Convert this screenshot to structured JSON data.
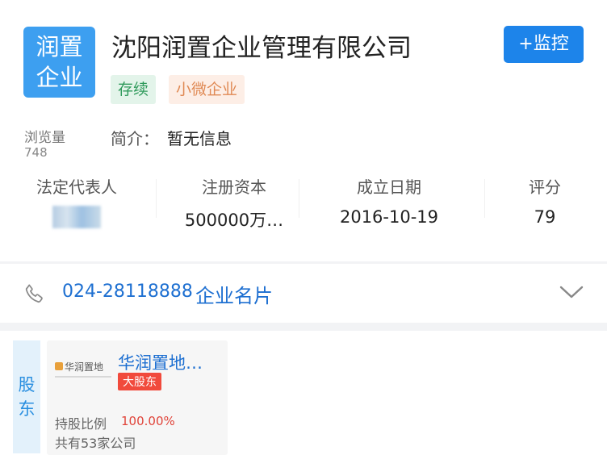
{
  "company": {
    "logo_line1": "润置",
    "logo_line2": "企业",
    "name": "沈阳润置企业管理有限公司",
    "status_tag": "存续",
    "scale_tag": "小微企业",
    "monitor_label": "+监控",
    "views_label": "浏览量",
    "views_count": "748",
    "intro_label": "简介：",
    "intro_value": "暂无信息"
  },
  "stats": {
    "legal_rep_label": "法定代表人",
    "capital_label": "注册资本",
    "capital_value": "500000万…",
    "date_label": "成立日期",
    "date_value": "2016-10-19",
    "score_label": "评分",
    "score_value": "79"
  },
  "contact": {
    "phone": "024-28118888",
    "business_card": "企业名片"
  },
  "shareholders": {
    "tab_line1": "股",
    "tab_line2": "东",
    "items": [
      {
        "logo_text": "华润置地",
        "name": "华润置地…",
        "badge": "大股东",
        "ratio_label": "持股比例",
        "ratio_value": "100.00%",
        "company_count": "共有53家公司"
      }
    ]
  },
  "colors": {
    "brand_blue": "#1d84ea",
    "logo_blue": "#3d9ff0",
    "link_blue": "#1d6fd1",
    "status_green": "#2f9a5b",
    "scale_orange": "#e08a55",
    "badge_red": "#f14a3c"
  }
}
